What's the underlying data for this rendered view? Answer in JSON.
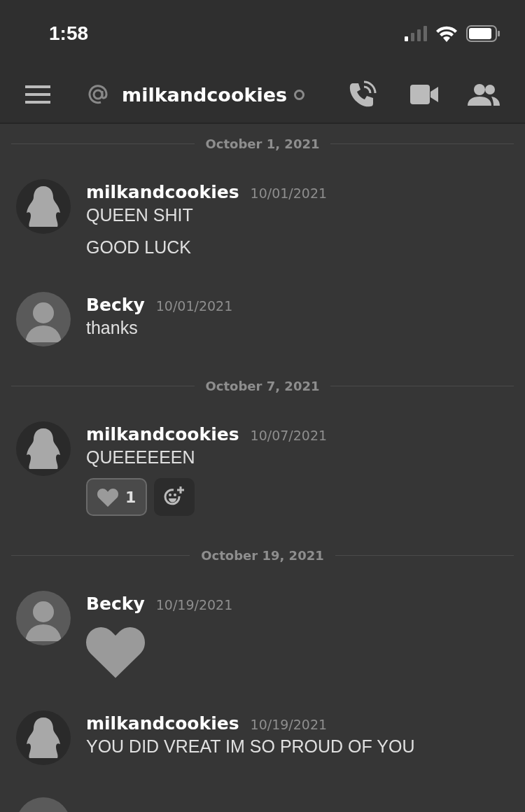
{
  "status_bar": {
    "time": "1:58"
  },
  "header": {
    "title": "milkandcookies",
    "online": false
  },
  "feed": [
    {
      "kind": "divider",
      "label": "October 1, 2021"
    },
    {
      "kind": "message",
      "author": "milkandcookies",
      "avatar": {
        "kind": "ghost"
      },
      "timestamp": "10/01/2021",
      "content": [
        {
          "kind": "text",
          "text": "QUEEN SHIT"
        },
        {
          "kind": "text",
          "text": "GOOD LUCK"
        }
      ]
    },
    {
      "kind": "message",
      "author": "Becky",
      "avatar": {
        "kind": "photo"
      },
      "timestamp": "10/01/2021",
      "content": [
        {
          "kind": "text",
          "text": "thanks"
        }
      ]
    },
    {
      "kind": "divider",
      "label": "October 7, 2021"
    },
    {
      "kind": "message",
      "author": "milkandcookies",
      "avatar": {
        "kind": "ghost"
      },
      "timestamp": "10/07/2021",
      "content": [
        {
          "kind": "text",
          "text": "QUEEEEEEN"
        }
      ],
      "reactions": [
        {
          "count": "1",
          "selected": true
        }
      ]
    },
    {
      "kind": "divider",
      "label": "October 19, 2021"
    },
    {
      "kind": "message",
      "author": "Becky",
      "avatar": {
        "kind": "photo"
      },
      "timestamp": "10/19/2021",
      "content": [
        {
          "kind": "heart"
        }
      ]
    },
    {
      "kind": "message",
      "author": "milkandcookies",
      "avatar": {
        "kind": "ghost"
      },
      "timestamp": "10/19/2021",
      "content": [
        {
          "kind": "text",
          "text": "YOU DID VREAT IM SO PROUD OF YOU"
        }
      ]
    },
    {
      "kind": "message",
      "avatar": {
        "kind": "photo"
      }
    }
  ]
}
